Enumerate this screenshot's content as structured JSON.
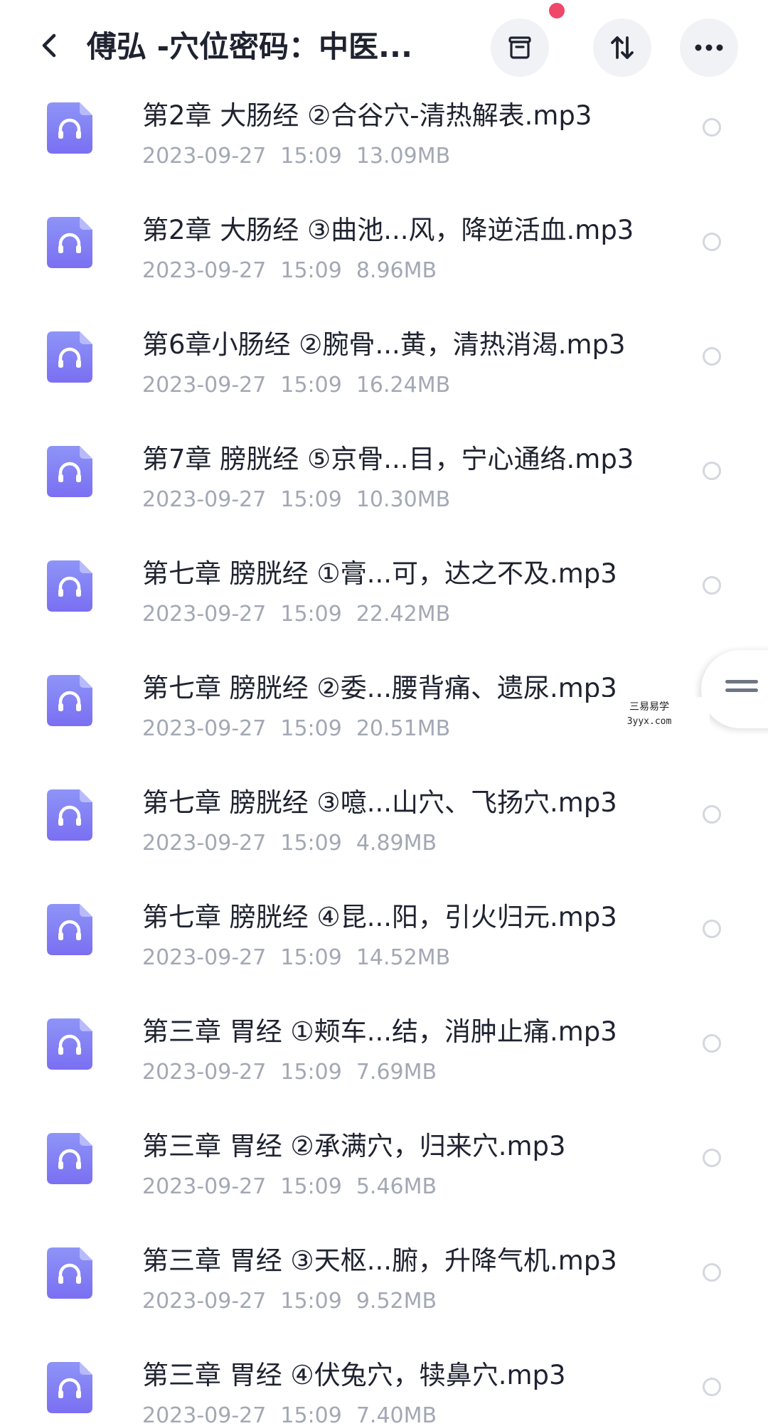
{
  "header": {
    "title": "傅弘 -穴位密码：中医...",
    "back_icon": "chevron-left-icon",
    "archive_icon": "archive-box-icon",
    "sort_icon": "sort-arrows-icon",
    "more_icon": "more-dots-icon",
    "notify_color": "#f0466a"
  },
  "colors": {
    "file_icon_top": "#8e94f7",
    "file_icon_bottom": "#7a6ff2",
    "text_primary": "#1f2330",
    "text_secondary": "#a3a8b4"
  },
  "files": [
    {
      "name": "第2章 大肠经 ②合谷穴-清热解表.mp3",
      "date": "2023-09-27",
      "time": "15:09",
      "size": "13.09MB"
    },
    {
      "name": "第2章 大肠经 ③曲池...风，降逆活血.mp3",
      "date": "2023-09-27",
      "time": "15:09",
      "size": "8.96MB"
    },
    {
      "name": "第6章小肠经 ②腕骨...黄，清热消渴.mp3",
      "date": "2023-09-27",
      "time": "15:09",
      "size": "16.24MB"
    },
    {
      "name": "第7章 膀胱经 ⑤京骨...目，宁心通络.mp3",
      "date": "2023-09-27",
      "time": "15:09",
      "size": "10.30MB"
    },
    {
      "name": "第七章 膀胱经 ①膏...可，达之不及.mp3",
      "date": "2023-09-27",
      "time": "15:09",
      "size": "22.42MB"
    },
    {
      "name": "第七章 膀胱经 ②委...腰背痛、遗尿.mp3",
      "date": "2023-09-27",
      "time": "15:09",
      "size": "20.51MB"
    },
    {
      "name": "第七章 膀胱经 ③噫...山穴、飞扬穴.mp3",
      "date": "2023-09-27",
      "time": "15:09",
      "size": "4.89MB"
    },
    {
      "name": "第七章 膀胱经 ④昆...阳，引火归元.mp3",
      "date": "2023-09-27",
      "time": "15:09",
      "size": "14.52MB"
    },
    {
      "name": "第三章 胃经 ①颊车...结，消肿止痛.mp3",
      "date": "2023-09-27",
      "time": "15:09",
      "size": "7.69MB"
    },
    {
      "name": "第三章 胃经 ②承满穴，归来穴.mp3",
      "date": "2023-09-27",
      "time": "15:09",
      "size": "5.46MB"
    },
    {
      "name": "第三章 胃经 ③天枢...腑，升降气机.mp3",
      "date": "2023-09-27",
      "time": "15:09",
      "size": "9.52MB"
    },
    {
      "name": "第三章 胃经 ④伏兔穴，犊鼻穴.mp3",
      "date": "2023-09-27",
      "time": "15:09",
      "size": "7.40MB"
    }
  ],
  "side_handle": {
    "icon": "drag-handle-icon"
  },
  "watermark": {
    "line1": "三易易学",
    "line2": "3yyx.com"
  }
}
